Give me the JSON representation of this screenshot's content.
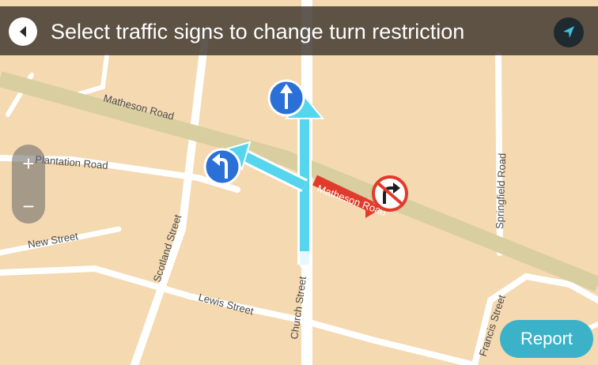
{
  "header": {
    "title": "Select traffic signs to change turn restriction",
    "back_icon": "arrow-left-icon",
    "compass_icon": "compass-arrow-icon"
  },
  "map": {
    "roads": {
      "matheson_upper": "Matheson Road",
      "matheson_lower": "Matheson Road",
      "plantation": "Plantation Road",
      "new_street": "New Street",
      "scotland_street": "Scotland Street",
      "church_street": "Church Street",
      "lewis_street": "Lewis Street",
      "springfield_road": "Springfield Road",
      "francis_street": "Francis Street"
    },
    "turn_signs": {
      "straight": "arrow-up-icon",
      "left": "turn-left-icon",
      "no_right_turn": "no-right-turn-icon"
    }
  },
  "zoom": {
    "in_label": "+",
    "out_label": "−"
  },
  "report": {
    "label": "Report"
  },
  "colors": {
    "map_background": "#f4d9b1",
    "main_road": "#d8cea0",
    "minor_road": "#ffffff",
    "route": "#55d6ee",
    "restricted_route": "#e13b2b",
    "sign_blue": "#2b70d6",
    "report_button": "#3bb2c8"
  }
}
